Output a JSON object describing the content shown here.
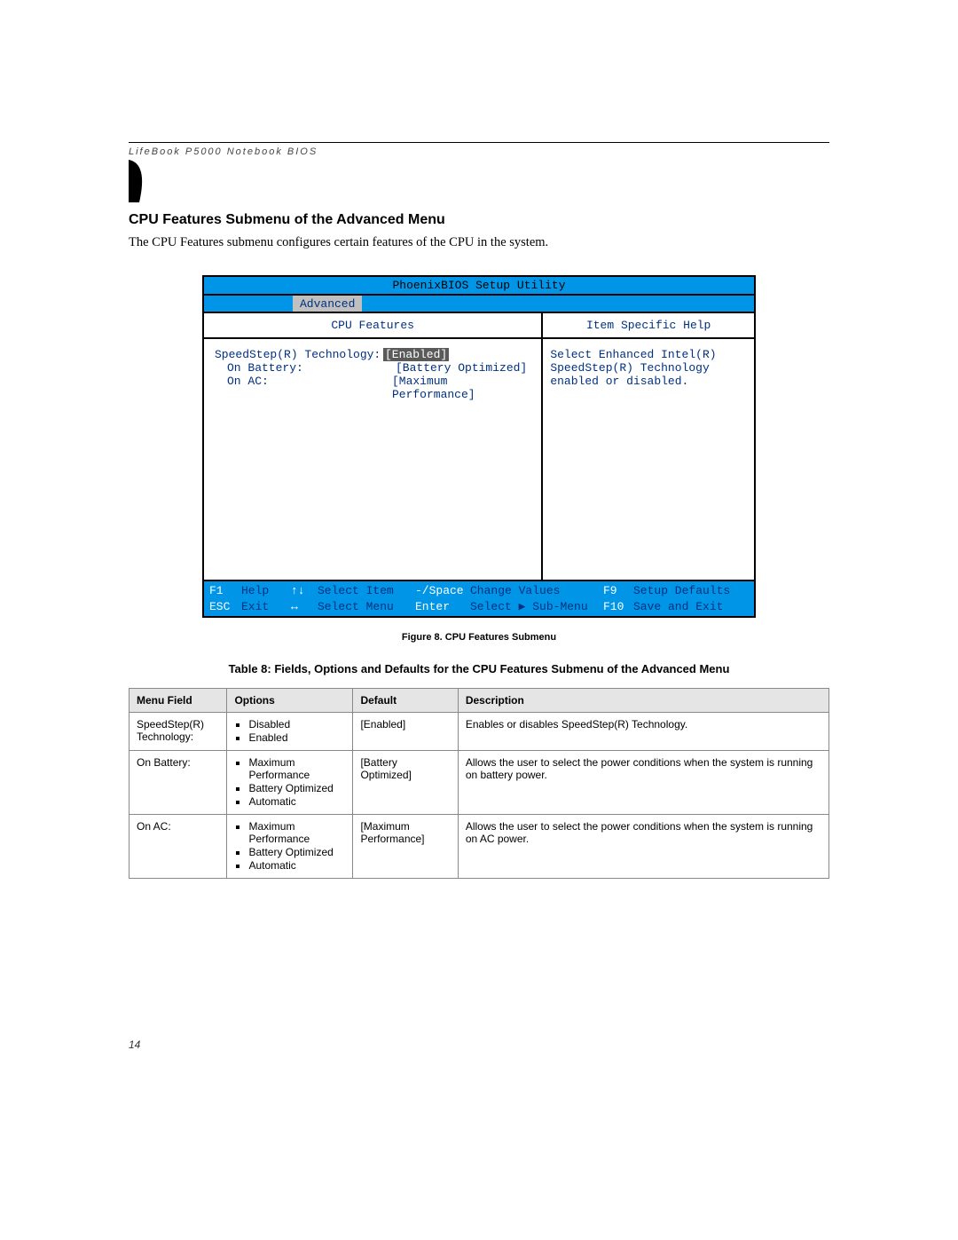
{
  "running_head": "LifeBook P5000 Notebook BIOS",
  "heading": "CPU Features Submenu of the Advanced Menu",
  "intro": "The CPU Features submenu configures certain features of the CPU in the system.",
  "bios": {
    "title": "PhoenixBIOS Setup Utility",
    "active_tab": "Advanced",
    "left_header": "CPU Features",
    "right_header": "Item Specific Help",
    "rows": [
      {
        "label": "SpeedStep(R) Technology:",
        "value": "[Enabled]",
        "selected": true,
        "indent": false
      },
      {
        "label": "On Battery:",
        "value": "[Battery Optimized]",
        "selected": false,
        "indent": true
      },
      {
        "label": "On AC:",
        "value": "[Maximum Performance]",
        "selected": false,
        "indent": true
      }
    ],
    "help_text": "Select Enhanced Intel(R) SpeedStep(R) Technology enabled or disabled.",
    "footer": {
      "r1": {
        "k1": "F1",
        "a1": "Help",
        "k2": "↑↓",
        "a2": "Select Item",
        "k3": "-/Space",
        "a3": "Change Values",
        "k4": "F9",
        "a4": "Setup Defaults"
      },
      "r2": {
        "k1": "ESC",
        "a1": "Exit",
        "k2": "↔",
        "a2": "Select Menu",
        "k3": "Enter",
        "a3": "Select ▶ Sub-Menu",
        "k4": "F10",
        "a4": "Save and Exit"
      }
    }
  },
  "figure_caption": "Figure 8.  CPU Features Submenu",
  "table_title": "Table 8: Fields, Options and Defaults for the CPU Features Submenu of the Advanced Menu",
  "table": {
    "headers": {
      "menu_field": "Menu Field",
      "options": "Options",
      "default": "Default",
      "description": "Description"
    },
    "rows": [
      {
        "menu_field": "SpeedStep(R) Technology:",
        "options": [
          "Disabled",
          "Enabled"
        ],
        "default": "[Enabled]",
        "description": "Enables or disables SpeedStep(R) Technology."
      },
      {
        "menu_field": "On Battery:",
        "options": [
          "Maximum Performance",
          "Battery Optimized",
          "Automatic"
        ],
        "default": "[Battery Optimized]",
        "description": "Allows the user to select the power conditions when the system is running on battery power."
      },
      {
        "menu_field": "On AC:",
        "options": [
          "Maximum Performance",
          "Battery Optimized",
          "Automatic"
        ],
        "default": "[Maximum Performance]",
        "description": "Allows the user to select the power conditions when the system is running on AC power."
      }
    ]
  },
  "page_number": "14"
}
